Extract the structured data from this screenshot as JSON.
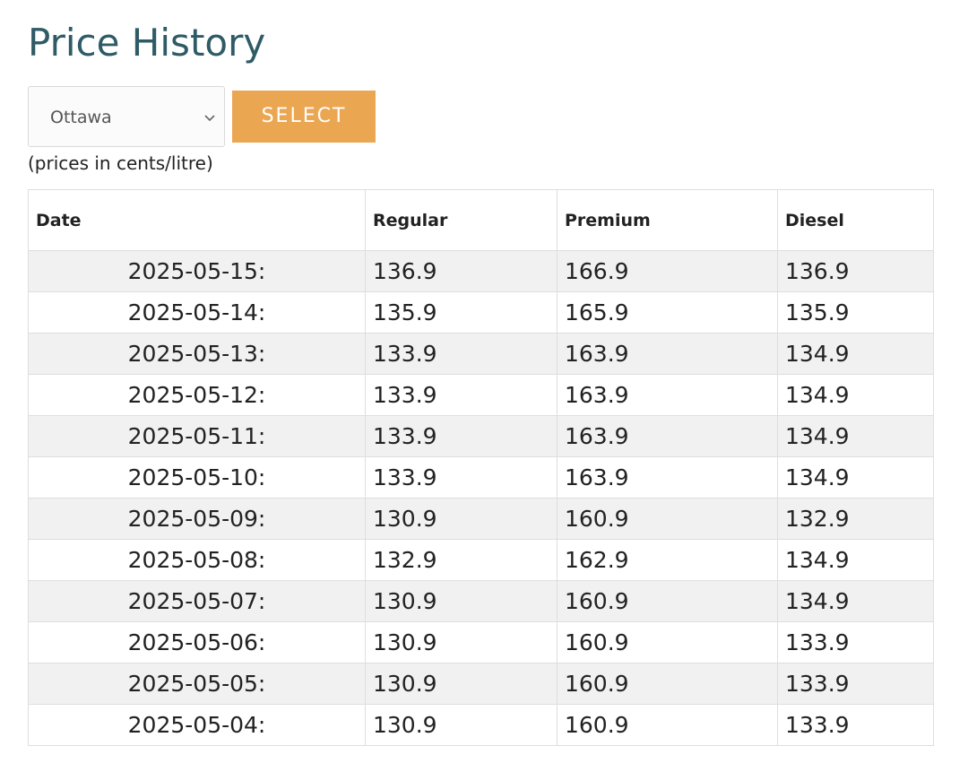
{
  "page": {
    "title": "Price History",
    "units_note": "(prices in cents/litre)"
  },
  "controls": {
    "city_select": {
      "selected": "Ottawa",
      "icon": "chevron-down-icon"
    },
    "select_button_label": "SELECT",
    "accent_color": "#eba651",
    "title_color": "#2e5b66"
  },
  "table": {
    "headers": {
      "date": "Date",
      "regular": "Regular",
      "premium": "Premium",
      "diesel": "Diesel"
    },
    "rows": [
      {
        "date": "2025-05-15:",
        "regular": "136.9",
        "premium": "166.9",
        "diesel": "136.9"
      },
      {
        "date": "2025-05-14:",
        "regular": "135.9",
        "premium": "165.9",
        "diesel": "135.9"
      },
      {
        "date": "2025-05-13:",
        "regular": "133.9",
        "premium": "163.9",
        "diesel": "134.9"
      },
      {
        "date": "2025-05-12:",
        "regular": "133.9",
        "premium": "163.9",
        "diesel": "134.9"
      },
      {
        "date": "2025-05-11:",
        "regular": "133.9",
        "premium": "163.9",
        "diesel": "134.9"
      },
      {
        "date": "2025-05-10:",
        "regular": "133.9",
        "premium": "163.9",
        "diesel": "134.9"
      },
      {
        "date": "2025-05-09:",
        "regular": "130.9",
        "premium": "160.9",
        "diesel": "132.9"
      },
      {
        "date": "2025-05-08:",
        "regular": "132.9",
        "premium": "162.9",
        "diesel": "134.9"
      },
      {
        "date": "2025-05-07:",
        "regular": "130.9",
        "premium": "160.9",
        "diesel": "134.9"
      },
      {
        "date": "2025-05-06:",
        "regular": "130.9",
        "premium": "160.9",
        "diesel": "133.9"
      },
      {
        "date": "2025-05-05:",
        "regular": "130.9",
        "premium": "160.9",
        "diesel": "133.9"
      },
      {
        "date": "2025-05-04:",
        "regular": "130.9",
        "premium": "160.9",
        "diesel": "133.9"
      }
    ]
  }
}
